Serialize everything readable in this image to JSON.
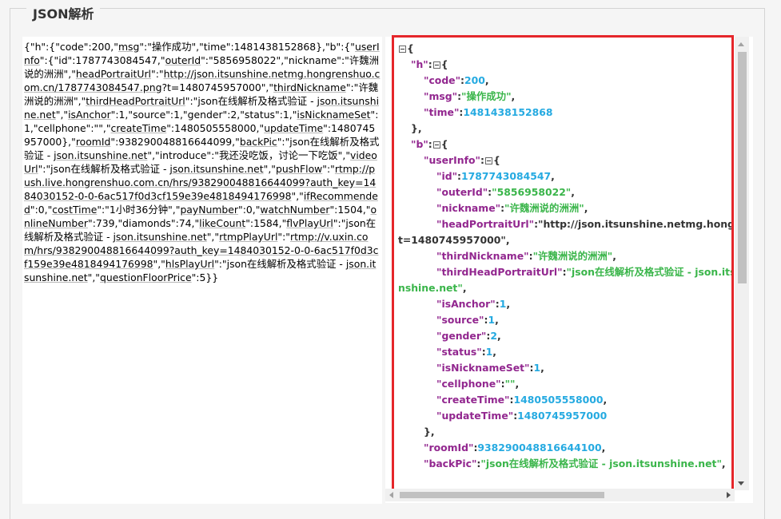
{
  "title": "JSON解析",
  "raw_json_segments": [
    "{\"h\":{\"code\":200,\"",
    {
      "u": "msg"
    },
    "\":\"操作成功\",\"time\":1481438152868},\"b\":{\"",
    {
      "u": "userInfo"
    },
    "\":{\"id\":1787743084547,\"",
    {
      "u": "outerId"
    },
    "\":\"5856958022\",\"nickname\":\"许魏洲说的洲洲\",\"",
    {
      "u": "headPortraitUrl"
    },
    "\":\"",
    {
      "u": "http://json.itsunshine.netmg.hongrenshuo.com.cn/1787743084547.png"
    },
    "?t=1480745957000\",\"",
    {
      "u": "thirdNickname"
    },
    "\":\"许魏洲说的洲洲\",\"",
    {
      "u": "thirdHeadPortraitUrl"
    },
    "\":\"json在线解析及格式验证 - ",
    {
      "u": "json.itsunshine.net"
    },
    "\",\"",
    {
      "u": "isAnchor"
    },
    "\":1,\"source\":1,\"gender\":2,\"status\":1,\"",
    {
      "u": "isNicknameSet"
    },
    "\":1,\"cellphone\":\"\",\"",
    {
      "u": "createTime"
    },
    "\":1480505558000,\"",
    {
      "u": "updateTime"
    },
    "\":1480745957000},\"",
    {
      "u": "roomId"
    },
    "\":938290048816644099,\"",
    {
      "u": "backPic"
    },
    "\":\"json在线解析及格式验证 - ",
    {
      "u": "json.itsunshine.net"
    },
    "\",\"introduce\":\"我还没吃饭，讨论一下吃饭\",\"",
    {
      "u": "videoUrl"
    },
    "\":\"json在线解析及格式验证 - ",
    {
      "u": "json.itsunshine.net"
    },
    "\",\"",
    {
      "u": "pushFlow"
    },
    "\":\"",
    {
      "u": "rtmp://push.live.hongrenshuo.com.cn/hrs/938290048816644099?auth_key=1484030152-0-0-6ac517f0d3cf159e39e4818494176998"
    },
    "\",\"",
    {
      "u": "ifRecommended"
    },
    "\":0,\"",
    {
      "u": "costTime"
    },
    "\":\"1小时36分钟\",\"",
    {
      "u": "payNumber"
    },
    "\":0,\"",
    {
      "u": "watchNumber"
    },
    "\":1504,\"",
    {
      "u": "onlineNumber"
    },
    "\":739,\"diamonds\":74,\"",
    {
      "u": "likeCount"
    },
    "\":1584,\"",
    {
      "u": "flvPlayUrl"
    },
    "\":\"json在线解析及格式验证 - ",
    {
      "u": "json.itsunshine.net"
    },
    "\",\"",
    {
      "u": "rtmpPlayUrl"
    },
    "\":\"",
    {
      "u": "rtmp://v.uxin.com/hrs/938290048816644099?auth_key=1484030152-0-0-6ac517f0d3cf159e39e4818494176998"
    },
    "\",\"",
    {
      "u": "hlsPlayUrl"
    },
    "\":\"json在线解析及格式验证 - ",
    {
      "u": "json.itsunshine.net"
    },
    "\",\"",
    {
      "u": "questionFloorPrice"
    },
    "\":5}}"
  ],
  "tree": [
    {
      "indent": 0,
      "toggle": true,
      "text": "{"
    },
    {
      "indent": 1,
      "key": "h",
      "toggle": true,
      "open": "{"
    },
    {
      "indent": 2,
      "key": "code",
      "num": "200",
      "comma": true
    },
    {
      "indent": 2,
      "key": "msg",
      "str": "\"操作成功\"",
      "comma": true
    },
    {
      "indent": 2,
      "key": "time",
      "num": "1481438152868"
    },
    {
      "indent": 1,
      "text": "},"
    },
    {
      "indent": 1,
      "key": "b",
      "toggle": true,
      "open": "{"
    },
    {
      "indent": 2,
      "key": "userInfo",
      "toggle": true,
      "open": "{"
    },
    {
      "indent": 3,
      "key": "id",
      "num": "1787743084547",
      "comma": true
    },
    {
      "indent": 3,
      "key": "outerId",
      "str": "\"5856958022\"",
      "comma": true
    },
    {
      "indent": 3,
      "key": "nickname",
      "str": "\"许魏洲说的洲洲\"",
      "comma": true
    },
    {
      "indent": 3,
      "key": "headPortraitUrl",
      "plain": "\"http://json.itsunshine.netmg.hongrenshuo.com.cn/1787743084547.png?"
    },
    {
      "indent": 0,
      "plain": "t=1480745957000\"",
      "comma": true
    },
    {
      "indent": 3,
      "key": "thirdNickname",
      "str": "\"许魏洲说的洲洲\"",
      "comma": true
    },
    {
      "indent": 3,
      "key": "thirdHeadPortraitUrl",
      "str": "\"json在线解析及格式验证 - json.itsunshine.net\"",
      "comma": true,
      "wrap": true
    },
    {
      "indent": 3,
      "key": "isAnchor",
      "num": "1",
      "comma": true
    },
    {
      "indent": 3,
      "key": "source",
      "num": "1",
      "comma": true
    },
    {
      "indent": 3,
      "key": "gender",
      "num": "2",
      "comma": true
    },
    {
      "indent": 3,
      "key": "status",
      "num": "1",
      "comma": true
    },
    {
      "indent": 3,
      "key": "isNicknameSet",
      "num": "1",
      "comma": true
    },
    {
      "indent": 3,
      "key": "cellphone",
      "str": "\"\"",
      "comma": true
    },
    {
      "indent": 3,
      "key": "createTime",
      "num": "1480505558000",
      "comma": true
    },
    {
      "indent": 3,
      "key": "updateTime",
      "num": "1480745957000"
    },
    {
      "indent": 2,
      "text": "},"
    },
    {
      "indent": 2,
      "key": "roomId",
      "num": "938290048816644100",
      "comma": true
    },
    {
      "indent": 2,
      "key": "backPic",
      "str": "\"json在线解析及格式验证 - json.itsunshine.net\"",
      "comma": true,
      "wrap": true
    }
  ]
}
